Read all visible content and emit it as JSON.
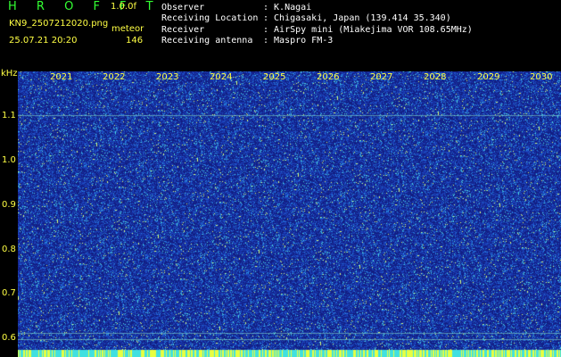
{
  "app": {
    "title": "H R O F F T",
    "version": "1.0.0f"
  },
  "file": {
    "name": "KN9_2507212020.png",
    "mode": "meteor",
    "datetime": "25.07.21 20:20",
    "count": "146"
  },
  "info": [
    {
      "key": "Observer",
      "value": ": K.Nagai"
    },
    {
      "key": "Receiving Location",
      "value": ": Chigasaki, Japan (139.414 35.340)"
    },
    {
      "key": "Receiver",
      "value": ": AirSpy mini (Miakejima VOR 108.65MHz)"
    },
    {
      "key": "Receiving antenna",
      "value": ": Maspro FM-3"
    }
  ],
  "y_axis": {
    "unit": "kHz",
    "ticks": [
      "1.1",
      "1.0",
      "0.9",
      "0.8",
      "0.7",
      "0.6"
    ]
  },
  "x_axis": {
    "labels": [
      "2021",
      "2022",
      "2023",
      "2024",
      "2025",
      "2026",
      "2027",
      "2028",
      "2029",
      "2030"
    ]
  },
  "colors": {
    "background": "#000000",
    "label": "#ffff44",
    "title": "#33ff33",
    "waterfall_base": "#1a2a9a"
  }
}
